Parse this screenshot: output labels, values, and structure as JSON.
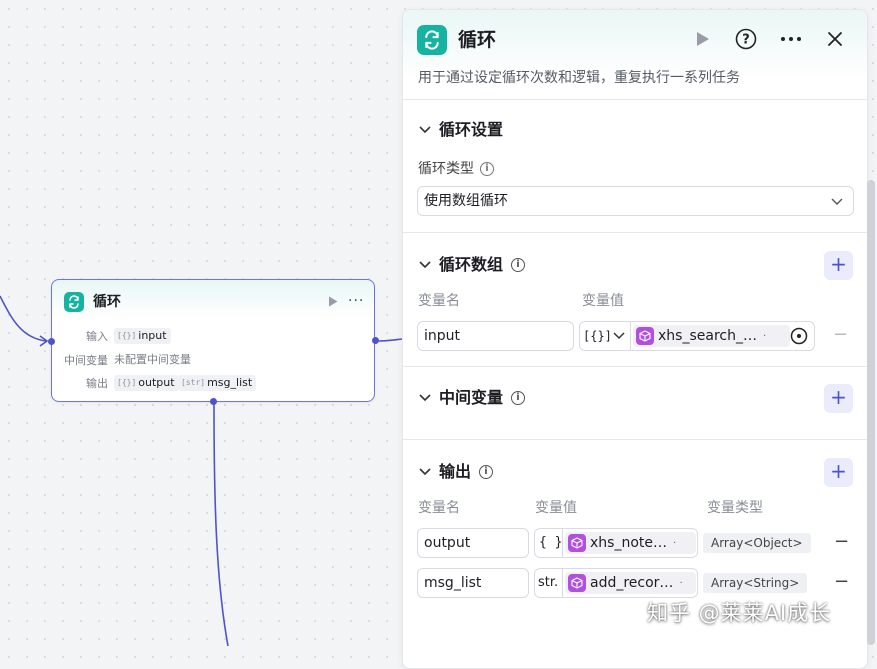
{
  "node": {
    "title": "循环",
    "rows": [
      {
        "label": "输入",
        "chips": [
          {
            "type": "[{}]",
            "name": "input"
          }
        ]
      },
      {
        "label": "中间变量",
        "text": "未配置中间变量"
      },
      {
        "label": "输出",
        "chips": [
          {
            "type": "[{}]",
            "name": "output"
          },
          {
            "type": "[str]",
            "name": "msg_list"
          }
        ]
      }
    ]
  },
  "panel": {
    "title": "循环",
    "description": "用于通过设定循环次数和逻辑，重复执行一系列任务",
    "icons": [
      "run-icon",
      "help-icon",
      "more-icon",
      "close-icon"
    ],
    "settings": {
      "section_title": "循环设置",
      "type_label": "循环类型",
      "type_value": "使用数组循环"
    },
    "array": {
      "section_title": "循环数组",
      "col_name": "变量名",
      "col_value": "变量值",
      "var_name": "input",
      "var_type_glyph": "[{}]",
      "ref_text": "xhs_search_…",
      "remove": "−"
    },
    "intermediate": {
      "section_title": "中间变量"
    },
    "output": {
      "section_title": "输出",
      "col_name": "变量名",
      "col_value": "变量值",
      "col_type": "变量类型",
      "rows": [
        {
          "name": "output",
          "type_glyph": "{ }",
          "ref_text": "xhs_note…",
          "var_type": "Array<Object>",
          "remove": "−"
        },
        {
          "name": "msg_list",
          "type_glyph": "str.",
          "ref_text": "add_recor…",
          "var_type": "Array<String>",
          "remove": "−"
        }
      ]
    },
    "add_label": "+"
  },
  "watermark": "知乎 @莱莱AI成长",
  "colors": {
    "accent": "#4e53c8",
    "teal": "#16b3a3",
    "ref_purple": "#b04fe0"
  }
}
